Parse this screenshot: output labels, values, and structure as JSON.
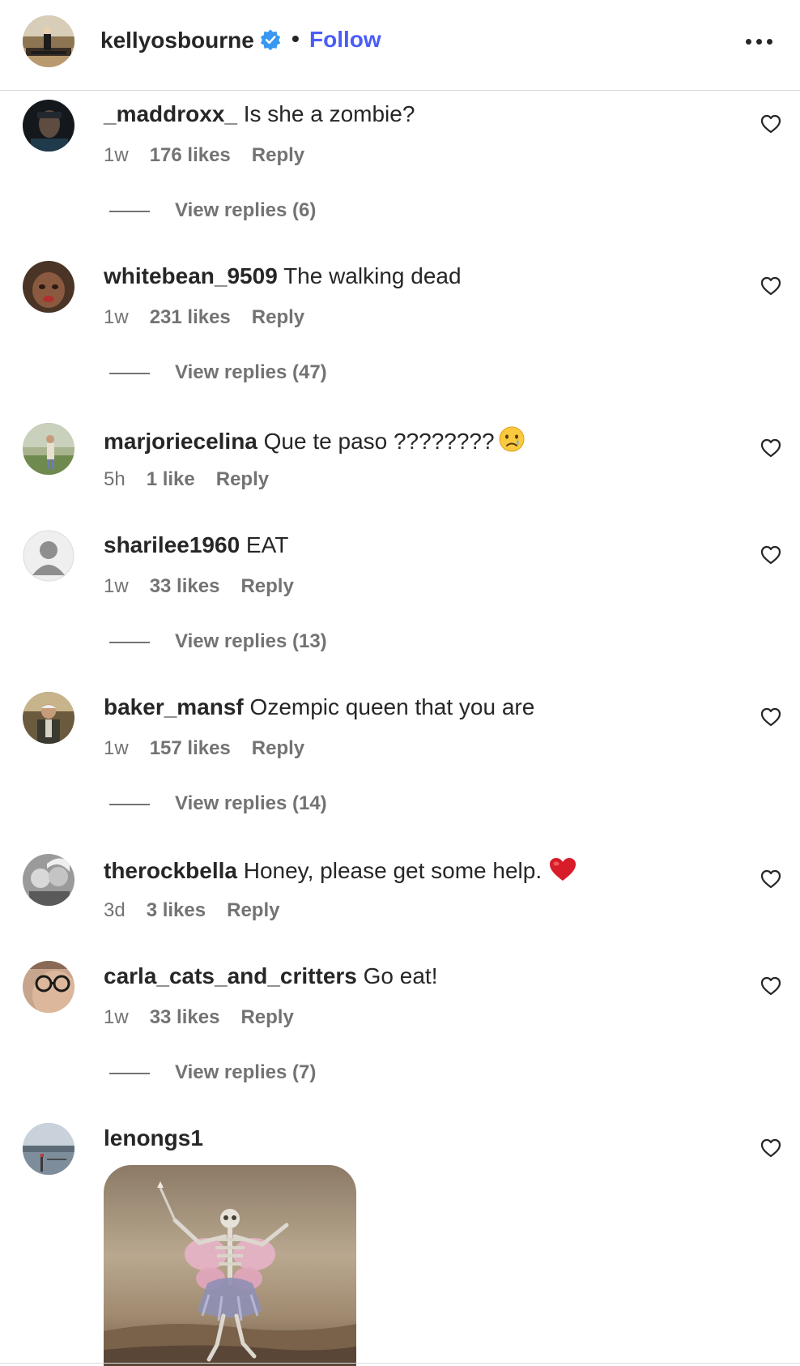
{
  "header": {
    "username": "kellyosbourne",
    "dot": "•",
    "follow_label": "Follow",
    "verified_icon": "verified-badge-icon",
    "more_icon": "more-options-icon",
    "accent_color": "#4a5df9"
  },
  "comments": [
    {
      "user": "_maddroxx_",
      "text": "Is she a zombie?",
      "time": "1w",
      "likes": "176 likes",
      "reply": "Reply",
      "view_replies": "View replies (6)"
    },
    {
      "user": "whitebean_9509",
      "text": "The walking dead",
      "time": "1w",
      "likes": "231 likes",
      "reply": "Reply",
      "view_replies": "View replies (47)"
    },
    {
      "user": "marjoriecelina",
      "text": "Que te paso ????????",
      "emoji": "crying-face-emoji",
      "time": "5h",
      "likes": "1 like",
      "reply": "Reply"
    },
    {
      "user": "sharilee1960",
      "text": "EAT",
      "time": "1w",
      "likes": "33 likes",
      "reply": "Reply",
      "view_replies": "View replies (13)"
    },
    {
      "user": "baker_mansf",
      "text": "Ozempic queen that you are",
      "time": "1w",
      "likes": "157 likes",
      "reply": "Reply",
      "view_replies": "View replies (14)"
    },
    {
      "user": "therockbella",
      "text": "Honey, please get some help.",
      "emoji": "red-heart-emoji",
      "time": "3d",
      "likes": "3 likes",
      "reply": "Reply"
    },
    {
      "user": "carla_cats_and_critters",
      "text": "Go eat!",
      "time": "1w",
      "likes": "33 likes",
      "reply": "Reply",
      "view_replies": "View replies (7)"
    },
    {
      "user": "lenongs1",
      "text": "",
      "attachment": "skeleton-fairy-gif"
    }
  ],
  "colors": {
    "text": "#262626",
    "secondary": "#737373",
    "divider": "#dbdbdb"
  }
}
